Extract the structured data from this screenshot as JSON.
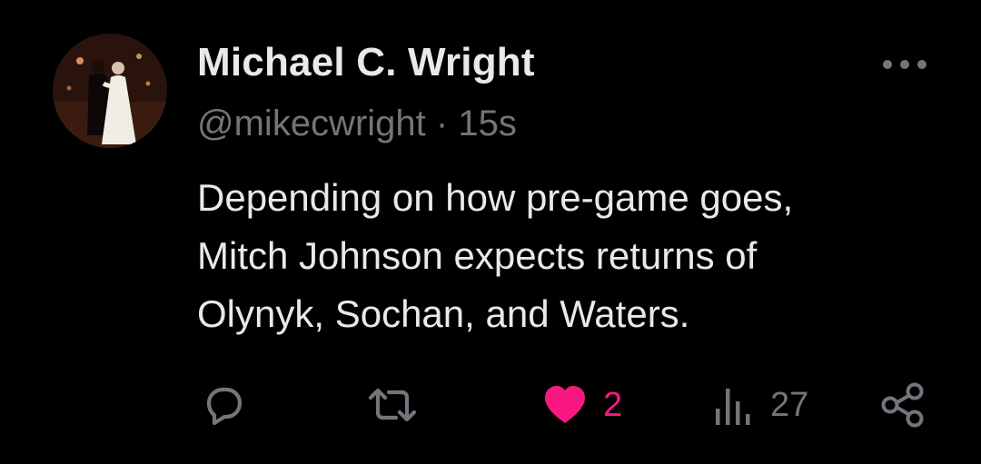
{
  "author": {
    "display_name": "Michael C. Wright",
    "handle": "@mikecwright",
    "separator": "·",
    "time": "15s"
  },
  "tweet": {
    "lines": [
      "Depending on how pre-game goes,",
      "Mitch Johnson expects returns of",
      "Olynyk, Sochan, and Waters."
    ]
  },
  "actions": {
    "reply": {
      "icon": "reply-icon"
    },
    "retweet": {
      "icon": "retweet-icon"
    },
    "like": {
      "icon": "heart-icon",
      "count": "2",
      "color": "#f91880"
    },
    "views": {
      "icon": "views-icon",
      "count": "27"
    },
    "share": {
      "icon": "share-icon"
    }
  },
  "colors": {
    "background": "#000000",
    "primary_text": "#e7e9ea",
    "secondary_text": "#71767b",
    "like_active": "#f91880"
  }
}
